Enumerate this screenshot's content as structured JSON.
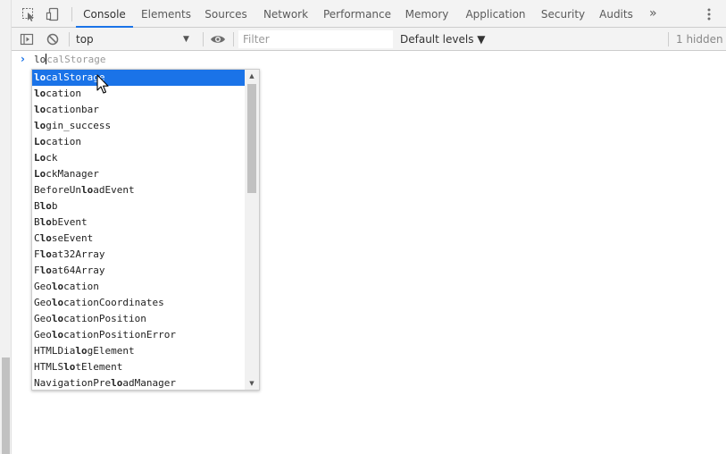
{
  "tabs": {
    "inspect_icon": "inspect-element-icon",
    "device_icon": "device-toolbar-icon",
    "items": [
      {
        "label": "Console",
        "active": true
      },
      {
        "label": "Elements",
        "active": false
      },
      {
        "label": "Sources",
        "active": false
      },
      {
        "label": "Network",
        "active": false
      },
      {
        "label": "Performance",
        "active": false
      },
      {
        "label": "Memory",
        "active": false
      },
      {
        "label": "Application",
        "active": false
      },
      {
        "label": "Security",
        "active": false
      },
      {
        "label": "Audits",
        "active": false
      }
    ],
    "more_label": "»",
    "accent_color": "#1a73e8"
  },
  "toolbar": {
    "context_value": "top",
    "filter_placeholder": "Filter",
    "levels_label": "Default levels ▼",
    "hidden_count": "1 hidden"
  },
  "console": {
    "prompt_chevron": "›",
    "typed": "lo",
    "ghost": "calStorage"
  },
  "autocomplete": {
    "items": [
      {
        "prefix": "",
        "match": "lo",
        "suffix": "calStorage"
      },
      {
        "prefix": "",
        "match": "lo",
        "suffix": "cation"
      },
      {
        "prefix": "",
        "match": "lo",
        "suffix": "cationbar"
      },
      {
        "prefix": "",
        "match": "lo",
        "suffix": "gin_success"
      },
      {
        "prefix": "",
        "match": "Lo",
        "suffix": "cation"
      },
      {
        "prefix": "",
        "match": "Lo",
        "suffix": "ck"
      },
      {
        "prefix": "",
        "match": "Lo",
        "suffix": "ckManager"
      },
      {
        "prefix": "BeforeUn",
        "match": "lo",
        "suffix": "adEvent"
      },
      {
        "prefix": "B",
        "match": "lo",
        "suffix": "b"
      },
      {
        "prefix": "B",
        "match": "lo",
        "suffix": "bEvent"
      },
      {
        "prefix": "C",
        "match": "lo",
        "suffix": "seEvent"
      },
      {
        "prefix": "F",
        "match": "lo",
        "suffix": "at32Array"
      },
      {
        "prefix": "F",
        "match": "lo",
        "suffix": "at64Array"
      },
      {
        "prefix": "Geo",
        "match": "lo",
        "suffix": "cation"
      },
      {
        "prefix": "Geo",
        "match": "lo",
        "suffix": "cationCoordinates"
      },
      {
        "prefix": "Geo",
        "match": "lo",
        "suffix": "cationPosition"
      },
      {
        "prefix": "Geo",
        "match": "lo",
        "suffix": "cationPositionError"
      },
      {
        "prefix": "HTMLDia",
        "match": "lo",
        "suffix": "gElement"
      },
      {
        "prefix": "HTMLS",
        "match": "lo",
        "suffix": "tElement"
      },
      {
        "prefix": "NavigationPre",
        "match": "lo",
        "suffix": "adManager"
      }
    ],
    "selected_index": 0,
    "selected_color": "#1a73e8"
  }
}
